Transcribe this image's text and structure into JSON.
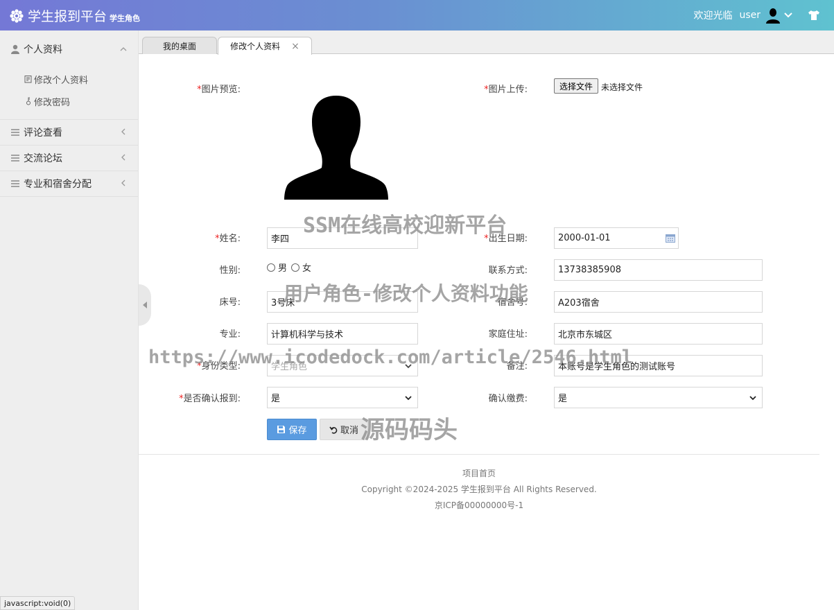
{
  "header": {
    "title": "学生报到平台",
    "subtitle": "学生角色",
    "welcome": "欢迎光临",
    "username": "user"
  },
  "sidebar": {
    "groups": [
      {
        "label": "个人资料",
        "items": [
          {
            "label": "修改个人资料"
          },
          {
            "label": "修改密码"
          }
        ]
      },
      {
        "label": "评论查看"
      },
      {
        "label": "交流论坛"
      },
      {
        "label": "专业和宿舍分配"
      }
    ]
  },
  "tabs": [
    {
      "label": "我的桌面"
    },
    {
      "label": "修改个人资料",
      "close": "×"
    }
  ],
  "form": {
    "photo_preview_label": "图片预览:",
    "photo_upload_label": "图片上传:",
    "file_button": "选择文件",
    "file_none": "未选择文件",
    "name_label": "姓名:",
    "name_value": "李四",
    "birth_label": "出生日期:",
    "birth_value": "2000-01-01",
    "gender_label": "性别:",
    "gender_options": [
      "男",
      "女"
    ],
    "contact_label": "联系方式:",
    "contact_value": "13738385908",
    "bed_label": "床号:",
    "bed_value": "3号床",
    "dorm_label": "宿舍号:",
    "dorm_value": "A203宿舍",
    "major_label": "专业:",
    "major_value": "计算机科学与技术",
    "address_label": "家庭住址:",
    "address_value": "北京市东城区",
    "identity_label": "身份类型:",
    "identity_value": "学生角色",
    "remark_label": "备注:",
    "remark_value": "本账号是学生角色的测试账号",
    "confirm_label": "是否确认报到:",
    "confirm_value": "是",
    "fee_label": "确认缴费:",
    "fee_value": "是",
    "required_mark": "*",
    "save_button": "保存",
    "cancel_button": "取消"
  },
  "footer": {
    "home_link": "项目首页",
    "copyright": "Copyright ©2024-2025 学生报到平台 All Rights Reserved.",
    "icp": "京ICP备00000000号-1"
  },
  "watermarks": {
    "line1": "SSM在线高校迎新平台",
    "line2": "用户角色-修改个人资料功能",
    "line3": "https://www.icodedock.com/article/2546.html",
    "line4": "源码码头"
  },
  "statusbar": "javascript:void(0)",
  "colors": {
    "header_start": "#7478d6",
    "header_end": "#5fc2d0",
    "primary_button": "#5a9be0",
    "required": "#e22222"
  }
}
